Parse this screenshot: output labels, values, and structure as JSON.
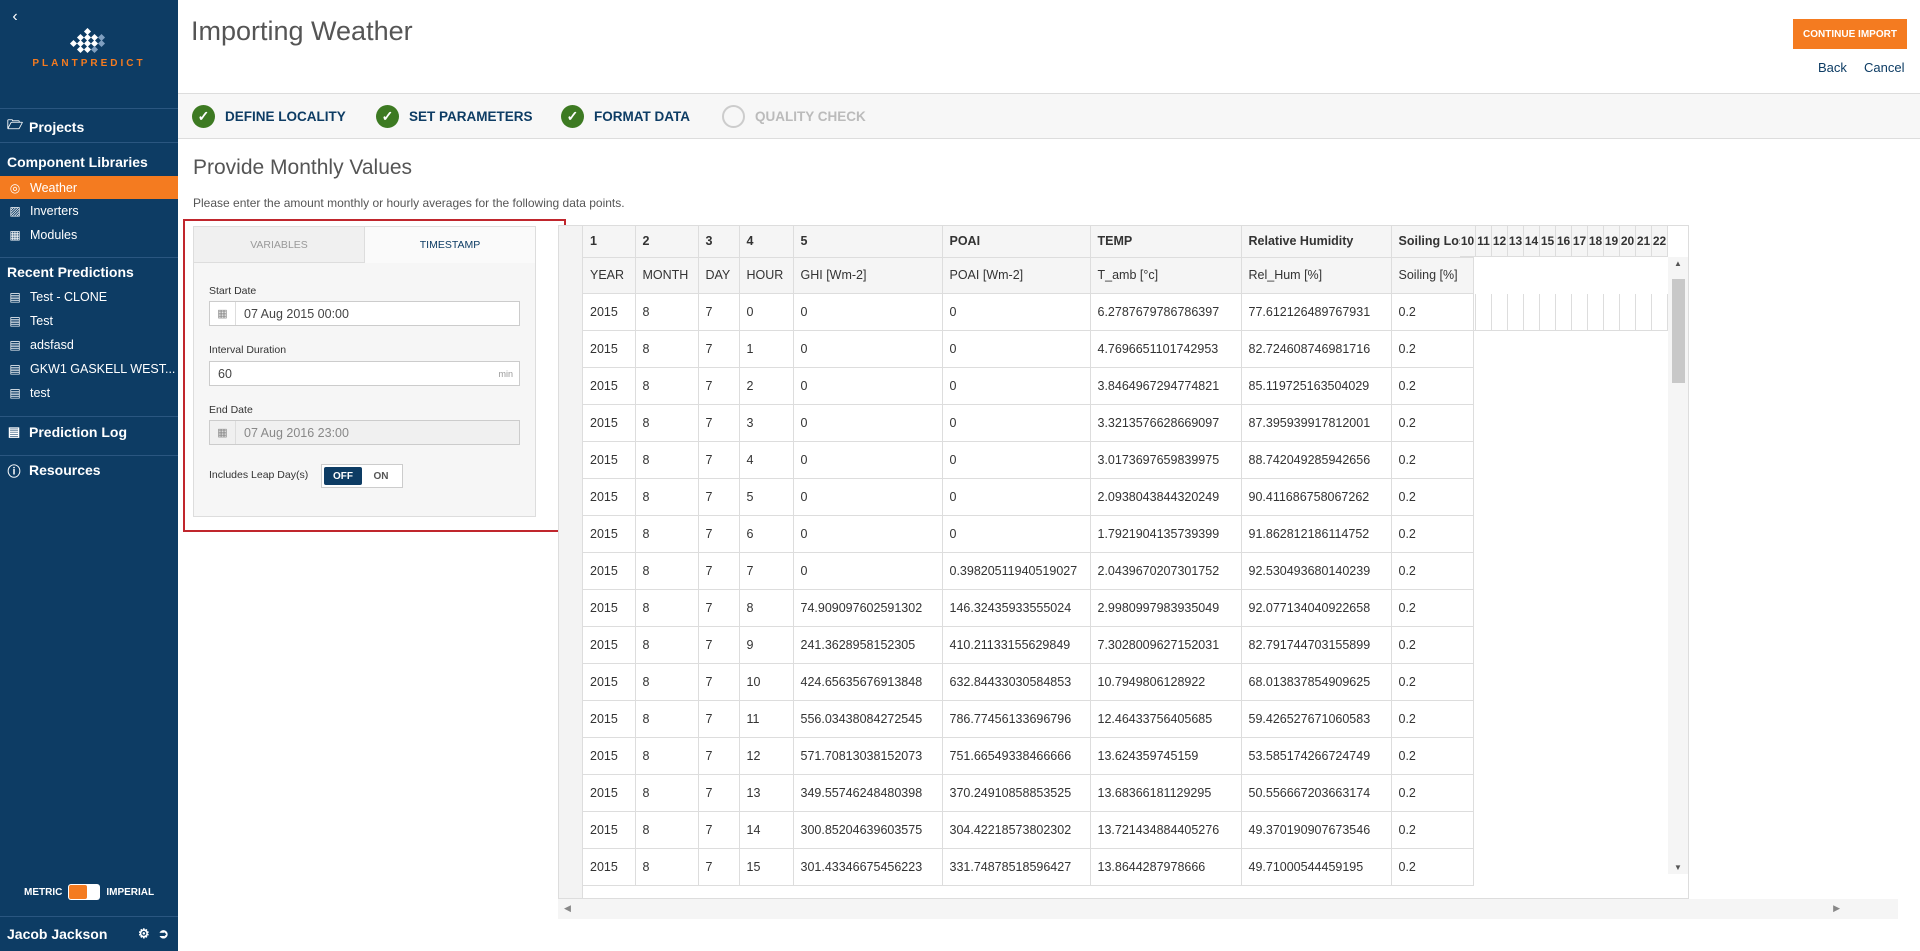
{
  "sidebar": {
    "logo_text_left": "PLANT",
    "logo_text_right": "PREDICT",
    "projects": "Projects",
    "component_libraries": "Component Libraries",
    "library_items": [
      "Weather",
      "Inverters",
      "Modules"
    ],
    "recent_predictions_title": "Recent Predictions",
    "recent_predictions": [
      "Test - CLONE",
      "Test",
      "adsfasd",
      "GKW1 GASKELL WEST...",
      "test"
    ],
    "prediction_log": "Prediction Log",
    "resources": "Resources",
    "units_metric": "METRIC",
    "units_imperial": "IMPERIAL",
    "user_name": "Jacob Jackson"
  },
  "header": {
    "title": "Importing Weather",
    "continue_label": "CONTINUE IMPORT",
    "back_label": "Back",
    "cancel_label": "Cancel"
  },
  "steps": [
    {
      "label": "DEFINE LOCALITY",
      "done": true
    },
    {
      "label": "SET PARAMETERS",
      "done": true
    },
    {
      "label": "FORMAT DATA",
      "done": true
    },
    {
      "label": "QUALITY CHECK",
      "done": false
    }
  ],
  "section": {
    "title": "Provide Monthly Values",
    "description": "Please enter the amount monthly or hourly averages for the following data points."
  },
  "form": {
    "tab_variables": "VARIABLES",
    "tab_timestamp": "TIMESTAMP",
    "start_date_label": "Start Date",
    "start_date_value": "07 Aug 2015 00:00",
    "interval_label": "Interval Duration",
    "interval_value": "60",
    "interval_unit": "min",
    "end_date_label": "End Date",
    "end_date_value": "07 Aug 2016 23:00",
    "leap_label": "Includes Leap Day(s)",
    "leap_off": "OFF",
    "leap_on": "ON"
  },
  "grid": {
    "header_row1": [
      "1",
      "2",
      "3",
      "4",
      "5",
      "POAI",
      "TEMP",
      "Relative Humidity",
      "Soiling Loss"
    ],
    "header_row2": [
      "YEAR",
      "MONTH",
      "DAY",
      "HOUR",
      "GHI [Wm-2]",
      "POAI [Wm-2]",
      "T_amb [°c]",
      "Rel_Hum [%]",
      "Soiling [%]"
    ],
    "extra_columns": [
      "10",
      "11",
      "12",
      "13",
      "14",
      "15",
      "16",
      "17",
      "18",
      "19",
      "20",
      "21",
      "22"
    ],
    "rows": [
      [
        "2015",
        "8",
        "7",
        "0",
        "0",
        "0",
        "6.2787679786786397",
        "77.612126489767931",
        "0.2"
      ],
      [
        "2015",
        "8",
        "7",
        "1",
        "0",
        "0",
        "4.7696651101742953",
        "82.724608746981716",
        "0.2"
      ],
      [
        "2015",
        "8",
        "7",
        "2",
        "0",
        "0",
        "3.8464967294774821",
        "85.119725163504029",
        "0.2"
      ],
      [
        "2015",
        "8",
        "7",
        "3",
        "0",
        "0",
        "3.3213576628669097",
        "87.395939917812001",
        "0.2"
      ],
      [
        "2015",
        "8",
        "7",
        "4",
        "0",
        "0",
        "3.0173697659839975",
        "88.742049285942656",
        "0.2"
      ],
      [
        "2015",
        "8",
        "7",
        "5",
        "0",
        "0",
        "2.0938043844320249",
        "90.411686758067262",
        "0.2"
      ],
      [
        "2015",
        "8",
        "7",
        "6",
        "0",
        "0",
        "1.7921904135739399",
        "91.862812186114752",
        "0.2"
      ],
      [
        "2015",
        "8",
        "7",
        "7",
        "0",
        "0.39820511940519027",
        "2.0439670207301752",
        "92.530493680140239",
        "0.2"
      ],
      [
        "2015",
        "8",
        "7",
        "8",
        "74.909097602591302",
        "146.32435933555024",
        "2.9980997983935049",
        "92.077134040922658",
        "0.2"
      ],
      [
        "2015",
        "8",
        "7",
        "9",
        "241.3628958152305",
        "410.21133155629849",
        "7.3028009627152031",
        "82.791744703155899",
        "0.2"
      ],
      [
        "2015",
        "8",
        "7",
        "10",
        "424.65635676913848",
        "632.84433030584853",
        "10.7949806128922",
        "68.013837854909625",
        "0.2"
      ],
      [
        "2015",
        "8",
        "7",
        "11",
        "556.03438084272545",
        "786.77456133696796",
        "12.46433756405685",
        "59.426527671060583",
        "0.2"
      ],
      [
        "2015",
        "8",
        "7",
        "12",
        "571.70813038152073",
        "751.66549338466666",
        "13.624359745159",
        "53.585174266724749",
        "0.2"
      ],
      [
        "2015",
        "8",
        "7",
        "13",
        "349.55746248480398",
        "370.24910858853525",
        "13.68366181129295",
        "50.556667203663174",
        "0.2"
      ],
      [
        "2015",
        "8",
        "7",
        "14",
        "300.85204639603575",
        "304.42218573802302",
        "13.721434884405276",
        "49.370190907673546",
        "0.2"
      ],
      [
        "2015",
        "8",
        "7",
        "15",
        "301.43346675456223",
        "331.74878518596427",
        "13.8644287978666",
        "49.71000544459195",
        "0.2"
      ]
    ]
  },
  "colors": {
    "accent": "#f47b20",
    "navy": "#0d3c64",
    "success": "#3d7a22",
    "highlight": "#c0262d"
  }
}
